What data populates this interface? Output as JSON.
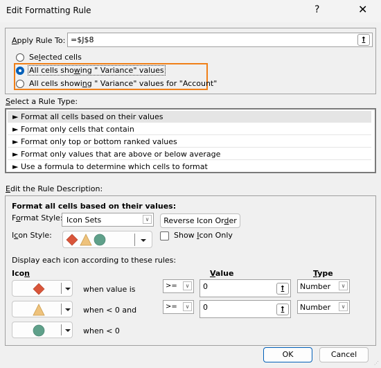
{
  "window": {
    "title": "Edit Formatting Rule",
    "help_label": "?",
    "close_label": "✕"
  },
  "apply": {
    "label_prefix": "A",
    "label_rest": "pply Rule To:",
    "value": "=$J$8",
    "collapse_icon": "⭡",
    "options": [
      {
        "label_pre": "Se",
        "label_u": "l",
        "label_post": "ected cells",
        "selected": false
      },
      {
        "label_pre": "All cells sho",
        "label_u": "w",
        "label_post": "ing \" Variance\" values",
        "selected": true
      },
      {
        "label_pre": "All cells showi",
        "label_u": "n",
        "label_post": "g \" Variance\" values for \"Account\"",
        "selected": false
      }
    ],
    "highlight_color": "#f07f17"
  },
  "rule_type": {
    "label_u": "S",
    "label_rest": "elect a Rule Type:",
    "items": [
      "► Format all cells based on their values",
      "► Format only cells that contain",
      "► Format only top or bottom ranked values",
      "► Format only values that are above or below average",
      "► Use a formula to determine which cells to format"
    ],
    "selected_index": 0
  },
  "description": {
    "label_u": "E",
    "label_rest": "dit the Rule Description:",
    "heading": "Format all cells based on their values:",
    "format_style_label_pre": "F",
    "format_style_label_u": "o",
    "format_style_label_post": "rmat Style:",
    "format_style_value": "Icon Sets",
    "reverse_pre": "Reverse Icon Or",
    "reverse_u": "d",
    "reverse_post": "er",
    "icon_style_label_pre": "I",
    "icon_style_label_u": "c",
    "icon_style_label_post": "on Style:",
    "show_icon_pre": "Show ",
    "show_icon_u": "I",
    "show_icon_post": "con Only",
    "show_icon_only": false,
    "display_rules_label": "Display each icon according to these rules:",
    "col_icon_pre": "Ico",
    "col_icon_u": "n",
    "col_value_u": "V",
    "col_value_rest": "alue",
    "col_type_u": "T",
    "col_type_rest": "ype",
    "rules": [
      {
        "icon": "red-diamond",
        "condition": "when value is",
        "operator": ">=",
        "value": "0",
        "type": "Number"
      },
      {
        "icon": "yellow-triangle",
        "condition": "when < 0 and",
        "operator": ">=",
        "value": "0",
        "type": "Number"
      },
      {
        "icon": "green-circle",
        "condition": "when < 0"
      }
    ]
  },
  "colors": {
    "red": "#d9553a",
    "yellow": "#eec27c",
    "green": "#5fa08a",
    "accent": "#005fb8"
  },
  "footer": {
    "ok_label": "OK",
    "cancel_label": "Cancel"
  }
}
